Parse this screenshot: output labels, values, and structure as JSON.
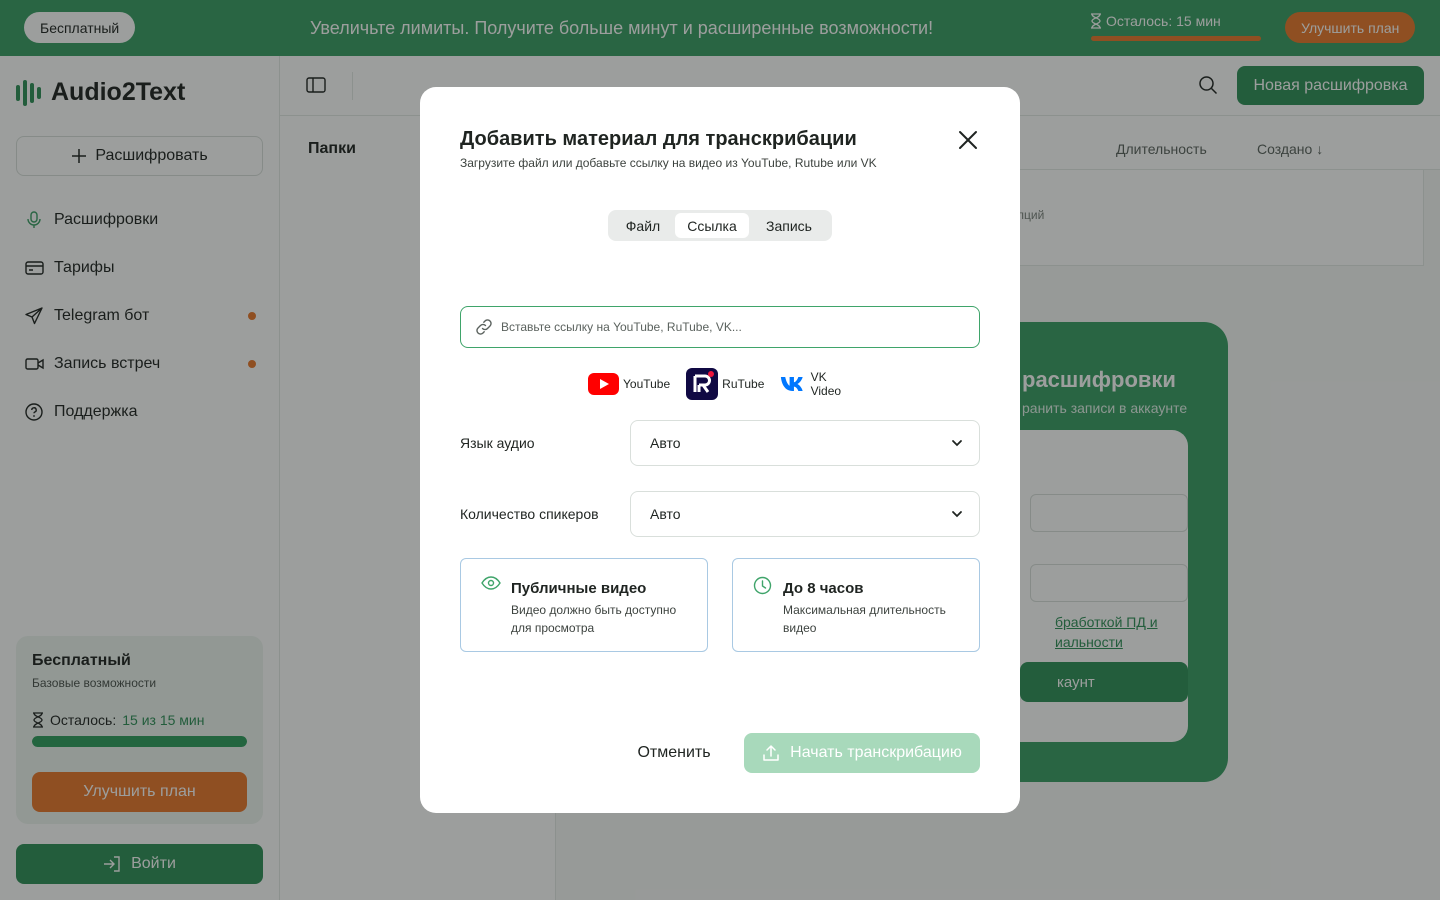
{
  "banner": {
    "plan_label": "Бесплатный",
    "promo_text": "Увеличьте лимиты. Получите больше минут и расширенные возможности!",
    "remaining_text": "Осталось: 15 мин",
    "remaining_progress": 1.0,
    "upgrade_label": "Улучшить план",
    "color_bg": "#3a9e64",
    "color_accent": "#e9772b"
  },
  "sidebar": {
    "app_name": "Audio2Text",
    "new_button_label": "Расшифровать",
    "items": [
      {
        "label": "Расшифровки",
        "icon": "microphone-icon",
        "badge": false
      },
      {
        "label": "Тарифы",
        "icon": "credit-card-icon",
        "badge": false
      },
      {
        "label": "Telegram бот",
        "icon": "telegram-send-icon",
        "badge": true
      },
      {
        "label": "Запись встреч",
        "icon": "video-camera-icon",
        "badge": true
      },
      {
        "label": "Поддержка",
        "icon": "help-circle-icon",
        "badge": false
      }
    ],
    "plan_card": {
      "title": "Бесплатный",
      "subtitle": "Базовые возможности",
      "remaining_label": "Осталось:",
      "remaining_value": "15 из 15 мин",
      "progress": 1.0,
      "upgrade_label": "Улучшить план"
    },
    "login_label": "Войти"
  },
  "topbar": {
    "new_button_label": "Новая расшифровка"
  },
  "background": {
    "folders_title": "Папки",
    "col_duration": "Длительность",
    "col_created": "Создано ↓",
    "empty_row_text": "лций",
    "promo_title": "расшифровки",
    "promo_subtitle": "ранить записи в аккаунте",
    "consent_line1": "бработкой ПД и",
    "consent_line2": "иальности",
    "account_button": "каунт"
  },
  "modal": {
    "title": "Добавить материал для транскрибации",
    "subtitle": "Загрузите файл или добавьте ссылку на видео из YouTube, Rutube или VK",
    "tabs": [
      {
        "label": "Файл",
        "active": false
      },
      {
        "label": "Ссылка",
        "active": true
      },
      {
        "label": "Запись",
        "active": false
      }
    ],
    "url_input": {
      "value": "",
      "placeholder": "Вставьте ссылку на YouTube, RuTube, VK..."
    },
    "platforms": [
      {
        "label": "YouTube",
        "icon": "youtube-icon",
        "color": "#ff0000"
      },
      {
        "label": "RuTube",
        "icon": "rutube-icon",
        "color": "#100943"
      },
      {
        "label": "VK Video",
        "icon": "vk-icon",
        "color": "#0077ff"
      }
    ],
    "language": {
      "label": "Язык аудио",
      "value": "Авто"
    },
    "speakers": {
      "label": "Количество спикеров",
      "value": "Авто"
    },
    "info_cards": [
      {
        "title": "Публичные видео",
        "desc": "Видео должно быть доступно для просмотра",
        "icon": "eye-icon"
      },
      {
        "title": "До 8 часов",
        "desc": "Максимальная длительность видео",
        "icon": "clock-icon"
      }
    ],
    "cancel_label": "Отменить",
    "start_label": "Начать транскрибацию",
    "start_color": "#a8d9bb",
    "accent_color": "#3fa46a"
  }
}
